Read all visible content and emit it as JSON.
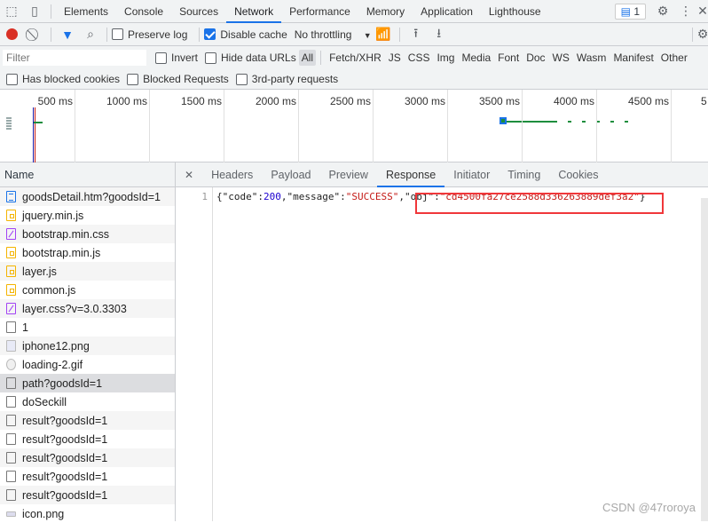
{
  "tabs": {
    "items": [
      "Elements",
      "Console",
      "Sources",
      "Network",
      "Performance",
      "Memory",
      "Application",
      "Lighthouse"
    ],
    "active": "Network",
    "issues_count": "1"
  },
  "toolbar": {
    "preserve_log": "Preserve log",
    "preserve_log_checked": false,
    "disable_cache": "Disable cache",
    "disable_cache_checked": true,
    "throttling": "No throttling"
  },
  "filters": {
    "placeholder": "Filter",
    "invert": "Invert",
    "hide_data_urls": "Hide data URLs",
    "types": [
      "All",
      "Fetch/XHR",
      "JS",
      "CSS",
      "Img",
      "Media",
      "Font",
      "Doc",
      "WS",
      "Wasm",
      "Manifest",
      "Other"
    ],
    "active_type": "All"
  },
  "blocked": {
    "has_blocked_cookies": "Has blocked cookies",
    "blocked_requests": "Blocked Requests",
    "third_party": "3rd-party requests"
  },
  "timeline": {
    "ticks": [
      "500 ms",
      "1000 ms",
      "1500 ms",
      "2000 ms",
      "2500 ms",
      "3000 ms",
      "3500 ms",
      "4000 ms",
      "4500 ms",
      "5"
    ]
  },
  "requests": {
    "header": "Name",
    "selected": "path?goodsId=1",
    "items": [
      {
        "name": "goodsDetail.htm?goodsId=1",
        "type": "document"
      },
      {
        "name": "jquery.min.js",
        "type": "script"
      },
      {
        "name": "bootstrap.min.css",
        "type": "stylesheet"
      },
      {
        "name": "bootstrap.min.js",
        "type": "script"
      },
      {
        "name": "layer.js",
        "type": "script"
      },
      {
        "name": "common.js",
        "type": "script"
      },
      {
        "name": "layer.css?v=3.0.3303",
        "type": "stylesheet"
      },
      {
        "name": "1",
        "type": "other"
      },
      {
        "name": "iphone12.png",
        "type": "image"
      },
      {
        "name": "loading-2.gif",
        "type": "gif"
      },
      {
        "name": "path?goodsId=1",
        "type": "other"
      },
      {
        "name": "doSeckill",
        "type": "other"
      },
      {
        "name": "result?goodsId=1",
        "type": "other"
      },
      {
        "name": "result?goodsId=1",
        "type": "other"
      },
      {
        "name": "result?goodsId=1",
        "type": "other"
      },
      {
        "name": "result?goodsId=1",
        "type": "other"
      },
      {
        "name": "result?goodsId=1",
        "type": "other"
      },
      {
        "name": "icon.png",
        "type": "icon"
      }
    ]
  },
  "detail": {
    "tabs": [
      "Headers",
      "Payload",
      "Preview",
      "Response",
      "Initiator",
      "Timing",
      "Cookies"
    ],
    "active": "Response",
    "line_number": "1",
    "response": {
      "p1": "{\"code\":",
      "code": "200",
      "p2": ",\"message\":",
      "message": "\"SUCCESS\"",
      "p3": ",\"obj\":",
      "obj": "\"cd4500fa27ce2588d336263889def3a2\"",
      "p4": "}"
    }
  },
  "watermark": "CSDN @47roroya",
  "colors": {
    "accent": "#1a73e8",
    "highlight_box": "#f0373a",
    "record": "#d93025"
  }
}
